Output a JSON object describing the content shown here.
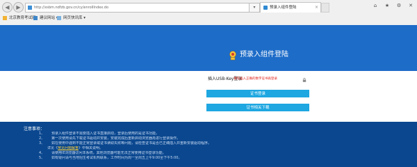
{
  "browser": {
    "back_icon": "back-arrow-icon",
    "forward_icon": "forward-arrow-icon",
    "address": "http://xsbm.ndfzb.gov.cn/cy/enrollIndex.do",
    "address_tools": "▾",
    "tab_title": "预录入组件登陆",
    "tab_close": "×",
    "controls": {
      "home": "⌂",
      "favorites": "★",
      "settings": "⚙",
      "close": "✕"
    },
    "favorites": [
      "北京教育考试网",
      "建议网站 ▾",
      "网页快讯库 ▾"
    ]
  },
  "page": {
    "title": "预录入组件登陆",
    "hint_label": "插入USB-Key登录",
    "hint_warning": "请先插入正确的数字证书再登录",
    "buttons": {
      "login": "证书登录",
      "download": "证书相关下载"
    }
  },
  "colors": {
    "header": "#1d6cc8",
    "button": "#1ea7e1",
    "footer": "#0a478f",
    "warning": "#e0241b"
  },
  "notices": {
    "title": "注意事项：",
    "items": [
      {
        "num": "1、",
        "text": "预录入组件登录不需要插入证书直接启动，登录后使用的是证书功能。"
      },
      {
        "num": "2、",
        "text": "第一次使用请先下载证书驱动并安装，安装完成后重新启动浏览器再进行登录操作。"
      },
      {
        "num": "3、",
        "text": "如在使用中遇到不能正常登录或证书读取失败等问题，请检查证书是否已正确插入并重新安装驱动程序。"
      },
      {
        "num": "",
        "text_before": "详见《",
        "link": "常见问题解答",
        "text_after": "》中相关说明。"
      },
      {
        "num": "4、",
        "text": "请使用IE浏览器访问本系统，其他浏览器可能无法正常使用证书登录功能。"
      },
      {
        "num": "5、",
        "text": "如有疑问请与当地招生考试机构联系，工作时间为周一至周五上午9:00至下午5:00。"
      }
    ]
  }
}
